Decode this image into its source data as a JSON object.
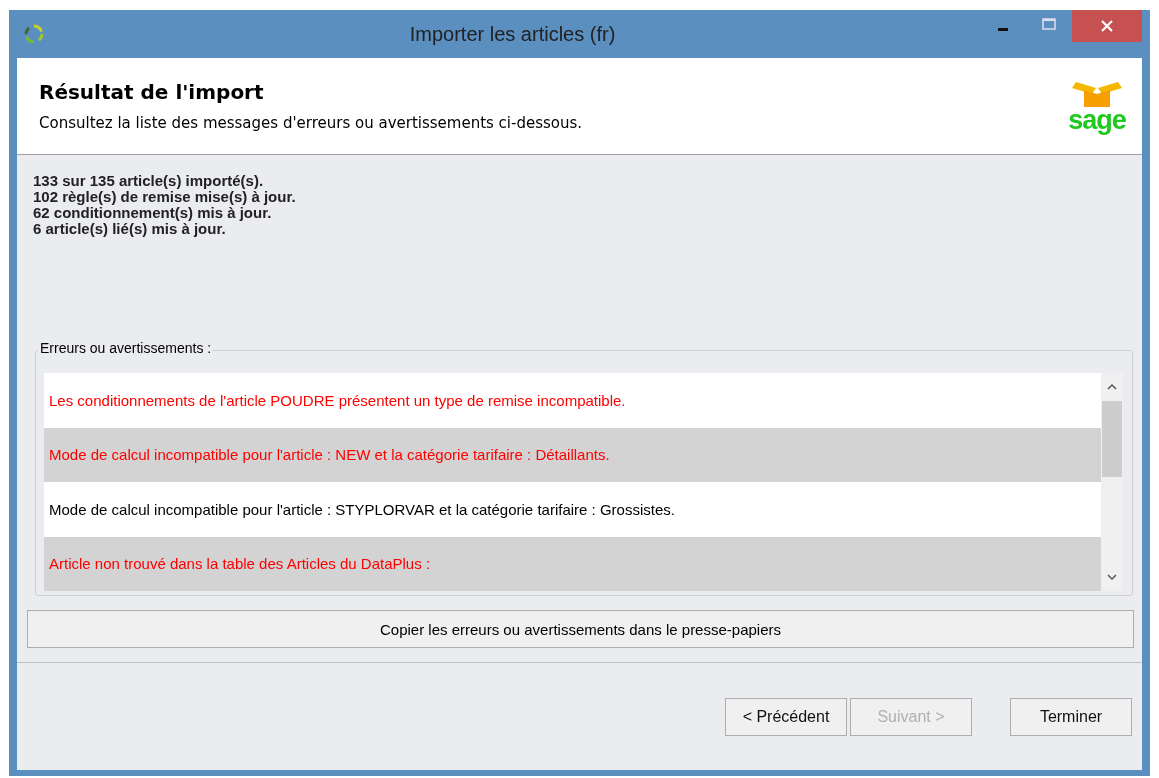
{
  "window": {
    "title": "Importer les articles (fr)"
  },
  "header": {
    "title": "Résultat de l'import",
    "subtitle": "Consultez la liste des messages d'erreurs ou avertissements ci-dessous.",
    "logo": "sage"
  },
  "summary": [
    "133 sur 135 article(s) importé(s).",
    "102 règle(s) de remise mise(s)  à jour.",
    "62 conditionnement(s) mis à jour.",
    "6 article(s) lié(s) mis à jour."
  ],
  "messages": {
    "label": "Erreurs ou avertissements :",
    "items": [
      {
        "text": "Les conditionnements de l'article POUDRE présentent un type de remise incompatible.",
        "color": "#ff0000"
      },
      {
        "text": "Mode de calcul incompatible pour l'article : NEW et la catégorie tarifaire : Détaillants.",
        "color": "#ff0000"
      },
      {
        "text": "Mode de calcul incompatible pour l'article : STYPLORVAR et la catégorie tarifaire : Grossistes.",
        "color": "#000000"
      },
      {
        "text": "Article non trouvé dans la table des Articles du DataPlus :",
        "color": "#ff0000"
      }
    ]
  },
  "copy_button": "Copier les erreurs ou avertissements dans le presse-papiers",
  "buttons": [
    {
      "label": "< Précédent",
      "disabled": false
    },
    {
      "label": "Suivant >",
      "disabled": true
    },
    {
      "label": "Terminer",
      "disabled": false
    }
  ]
}
